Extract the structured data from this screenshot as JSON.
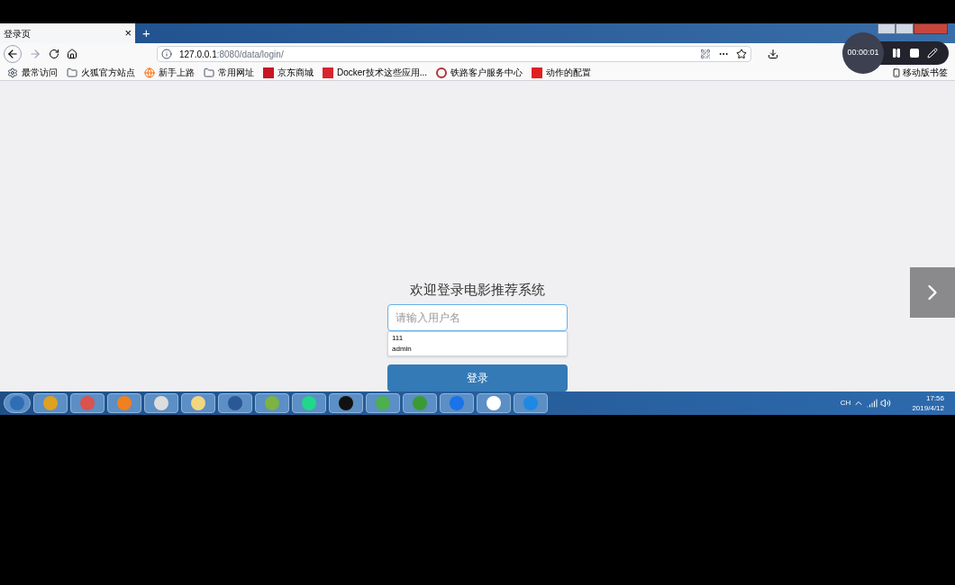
{
  "browser": {
    "tab": {
      "title": "登录页",
      "close": "×",
      "selected": true
    },
    "new_tab": "+",
    "url_host": "127.0.0.1",
    "url_rest": ":8080/data/login/",
    "bookmarks": [
      {
        "kind": "gear",
        "label": "最常访问"
      },
      {
        "kind": "folder",
        "label": "火狐官方站点"
      },
      {
        "kind": "globe",
        "label": "新手上路"
      },
      {
        "kind": "folder",
        "label": "常用网址"
      },
      {
        "kind": "jd",
        "label": "京东商城"
      },
      {
        "kind": "c",
        "label": "Docker技术这些应用..."
      },
      {
        "kind": "ring",
        "label": "铁路客户服务中心"
      },
      {
        "kind": "z",
        "label": "动作的配置"
      }
    ],
    "mobile_bookmarks": "移动版书签"
  },
  "recorder": {
    "time": "00:00:01"
  },
  "login": {
    "title": "欢迎登录电影推荐系统",
    "placeholder": "请输入用户名",
    "suggestions": [
      "111",
      "admin"
    ],
    "button": "登录"
  },
  "taskbar": {
    "apps": [
      {
        "kind": "start"
      },
      {
        "kind": "vm"
      },
      {
        "kind": "fish"
      },
      {
        "kind": "firefox"
      },
      {
        "kind": "avatar"
      },
      {
        "kind": "folder"
      },
      {
        "kind": "word"
      },
      {
        "kind": "notepad"
      },
      {
        "kind": "pc"
      },
      {
        "kind": "cmd"
      },
      {
        "kind": "wechat"
      },
      {
        "kind": "leaf"
      },
      {
        "kind": "k"
      },
      {
        "kind": "cloud"
      },
      {
        "kind": "video"
      }
    ],
    "tray": {
      "lang": "CH",
      "time": "17:56",
      "date": "2019/4/12"
    }
  }
}
